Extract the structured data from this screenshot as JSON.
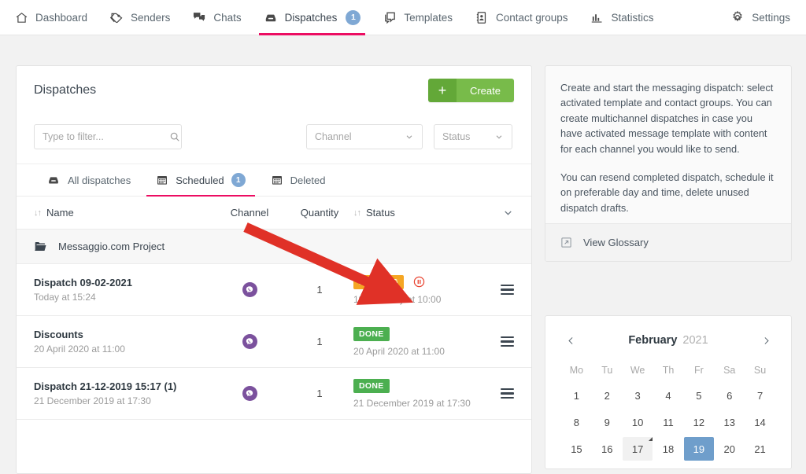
{
  "nav": {
    "items": [
      {
        "label": "Dashboard",
        "icon": "home-icon",
        "active": false,
        "badge": ""
      },
      {
        "label": "Senders",
        "icon": "tag-icon",
        "active": false,
        "badge": ""
      },
      {
        "label": "Chats",
        "icon": "chat-icon",
        "active": false,
        "badge": ""
      },
      {
        "label": "Dispatches",
        "icon": "inbox-icon",
        "active": true,
        "badge": "1"
      },
      {
        "label": "Templates",
        "icon": "template-icon",
        "active": false,
        "badge": ""
      },
      {
        "label": "Contact groups",
        "icon": "contacts-icon",
        "active": false,
        "badge": ""
      },
      {
        "label": "Statistics",
        "icon": "bar-chart-icon",
        "active": false,
        "badge": ""
      }
    ],
    "settings": {
      "label": "Settings",
      "icon": "gear-icon"
    }
  },
  "panel": {
    "title": "Dispatches",
    "create_label": "Create",
    "create_plus": "+"
  },
  "filters": {
    "search_placeholder": "Type to filter...",
    "search_value": "",
    "channel_label": "Channel",
    "status_label": "Status"
  },
  "tabs": [
    {
      "label": "All dispatches",
      "icon": "inbox-icon",
      "badge": "",
      "active": false
    },
    {
      "label": "Scheduled",
      "icon": "calendar-icon",
      "badge": "1",
      "active": true
    },
    {
      "label": "Deleted",
      "icon": "calendar-icon",
      "badge": "",
      "active": false
    }
  ],
  "table": {
    "headers": {
      "name": "Name",
      "channel": "Channel",
      "quantity": "Quantity",
      "status": "Status"
    },
    "group": {
      "label": "Messaggio.com Project",
      "icon": "folder-icon"
    },
    "rows": [
      {
        "name": "Dispatch 09-02-2021",
        "subtitle": "Today at 15:24",
        "channel": "viber-icon",
        "quantity": "1",
        "status": "PENDING",
        "status_kind": "pending",
        "status_time": "19 February at 10:00",
        "has_pause": true
      },
      {
        "name": "Discounts",
        "subtitle": "20 April 2020 at 11:00",
        "channel": "viber-icon",
        "quantity": "1",
        "status": "DONE",
        "status_kind": "done",
        "status_time": "20 April 2020 at 11:00",
        "has_pause": false
      },
      {
        "name": "Dispatch 21-12-2019 15:17 (1)",
        "subtitle": "21 December 2019 at 17:30",
        "channel": "viber-icon",
        "quantity": "1",
        "status": "DONE",
        "status_kind": "done",
        "status_time": "21 December 2019 at 17:30",
        "has_pause": false
      }
    ]
  },
  "side_info": {
    "paragraph_1": "Create and start the messaging dispatch: select activated template and contact groups. You can create multichannel dispatches in case you have activated message template with content for each channel you would like to send.",
    "paragraph_2": "You can resend completed dispatch, schedule it on preferable day and time, delete unused dispatch drafts.",
    "glossary_label": "View Glossary"
  },
  "calendar": {
    "month": "February",
    "year": "2021",
    "prev": "‹",
    "next": "›",
    "weekdays": [
      "Mo",
      "Tu",
      "We",
      "Th",
      "Fr",
      "Sa",
      "Su"
    ],
    "weeks": [
      [
        {
          "d": "1"
        },
        {
          "d": "2"
        },
        {
          "d": "3"
        },
        {
          "d": "4"
        },
        {
          "d": "5"
        },
        {
          "d": "6"
        },
        {
          "d": "7"
        }
      ],
      [
        {
          "d": "8"
        },
        {
          "d": "9"
        },
        {
          "d": "10"
        },
        {
          "d": "11"
        },
        {
          "d": "12"
        },
        {
          "d": "13"
        },
        {
          "d": "14"
        }
      ],
      [
        {
          "d": "15"
        },
        {
          "d": "16"
        },
        {
          "d": "17",
          "state": "today"
        },
        {
          "d": "18"
        },
        {
          "d": "19",
          "state": "selected"
        },
        {
          "d": "20"
        },
        {
          "d": "21"
        }
      ]
    ]
  },
  "colors": {
    "accent_pink": "#ec0d62",
    "create_green": "#78bb4a",
    "badge_pending": "#f5a623",
    "badge_done": "#4caf50",
    "viber_purple": "#7b519d",
    "calendar_selected": "#6f9ecb",
    "annotation_red": "#e03127",
    "nav_badge_blue": "#7fa8d4"
  },
  "annotation": {
    "type": "arrow",
    "points_to": "pause-dispatch-icon"
  }
}
